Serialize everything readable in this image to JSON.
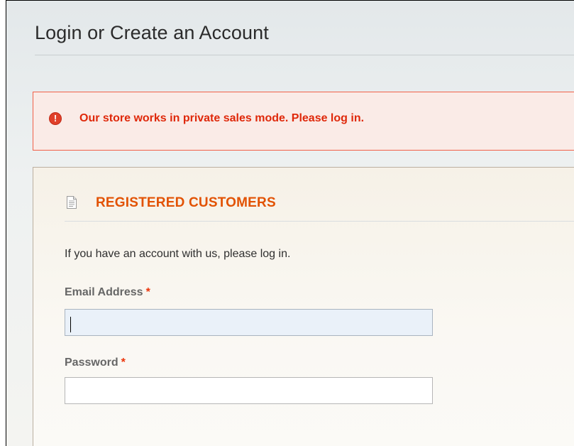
{
  "page": {
    "title": "Login or Create an Account"
  },
  "error": {
    "message": "Our store works in private sales mode. Please log in.",
    "icon": "error-icon"
  },
  "registered": {
    "section_title": "REGISTERED CUSTOMERS",
    "section_icon": "document-icon",
    "intro": "If you have an account with us, please log in.",
    "email": {
      "label": "Email Address",
      "required_mark": "*",
      "value": ""
    },
    "password": {
      "label": "Password",
      "required_mark": "*",
      "value": ""
    }
  },
  "colors": {
    "error_text": "#df280a",
    "error_bg": "#faebe7",
    "error_border": "#f16048",
    "section_title": "#e25203",
    "required": "#eb340a"
  }
}
